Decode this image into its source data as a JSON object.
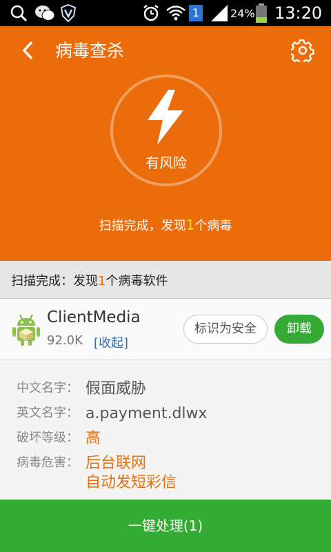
{
  "status_bar": {
    "battery": "24%",
    "time": "13:20",
    "sim_badge": "1",
    "icons": [
      "search-icon",
      "wechat-icon",
      "v-shield-icon",
      "alarm-icon",
      "wifi-icon",
      "sim-icon",
      "signal-icon",
      "battery-icon"
    ]
  },
  "header": {
    "title": "病毒查杀",
    "risk_label": "有风险",
    "scan_result": {
      "prefix": "扫描完成，发现",
      "count": "1",
      "suffix": "个病毒"
    }
  },
  "section": {
    "prefix": "扫描完成：发现",
    "count": "1",
    "suffix": "个病毒软件"
  },
  "app": {
    "name": "ClientMedia",
    "size": "92.0K",
    "collapse_label": "[收起]",
    "mark_safe_label": "标识为安全",
    "uninstall_label": "卸载"
  },
  "details": [
    {
      "label": "中文名字：",
      "value": "假面威胁",
      "highlight": false
    },
    {
      "label": "英文名字：",
      "value": "a.payment.dlwx",
      "highlight": false
    },
    {
      "label": "破坏等级：",
      "value": "高",
      "highlight": true
    },
    {
      "label": "病毒危害：",
      "values": [
        "后台联网",
        "自动发短彩信"
      ],
      "highlight": true
    }
  ],
  "action": {
    "label": "一键处理(1)"
  },
  "colors": {
    "header_orange": "#ea6c0a",
    "danger_orange": "#e8700e",
    "green": "#37a935",
    "link_blue": "#2a6fc0"
  }
}
